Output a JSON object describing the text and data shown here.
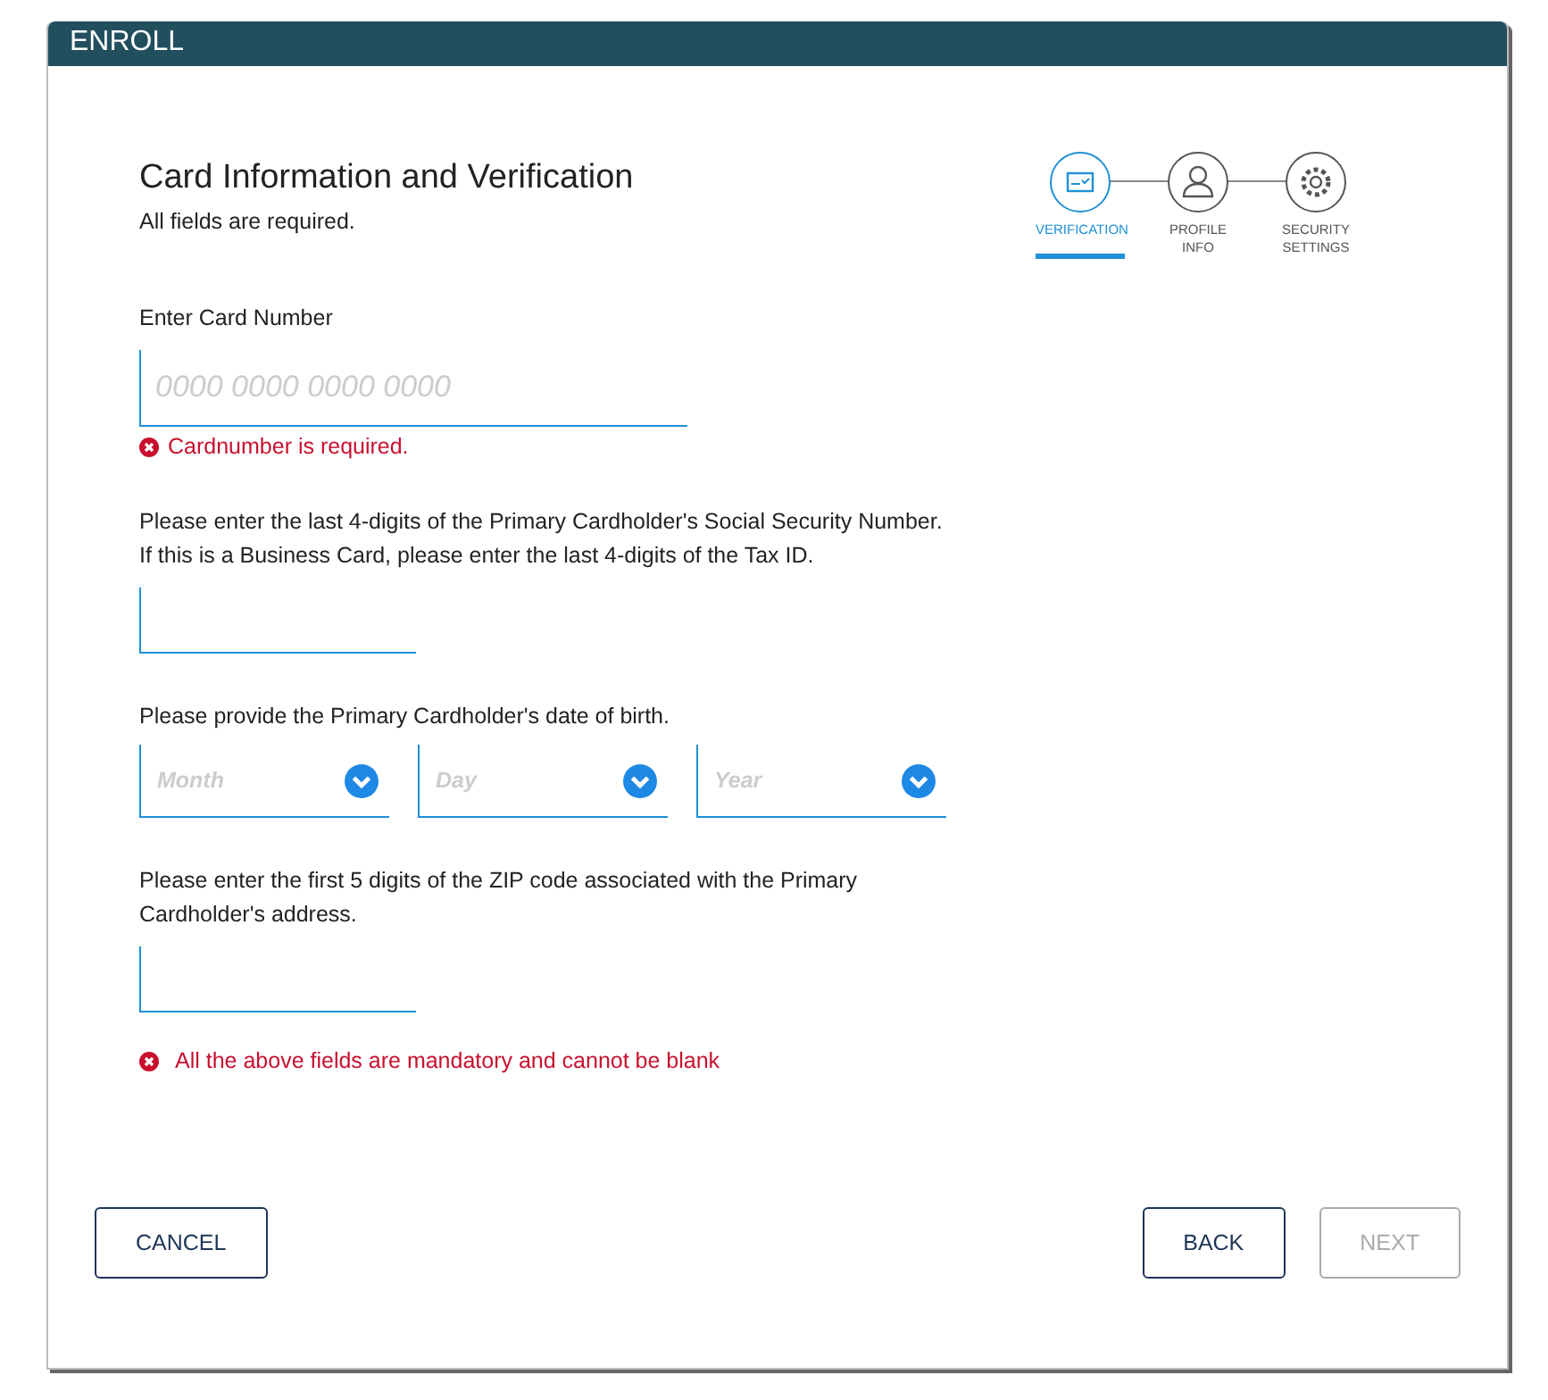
{
  "window": {
    "title": "ENROLL"
  },
  "heading": "Card Information and Verification",
  "subheading": "All fields are required.",
  "steps": [
    {
      "label": "VERIFICATION",
      "selected": true,
      "kind": "card"
    },
    {
      "label": "PROFILE INFO",
      "selected": false,
      "kind": "person"
    },
    {
      "label": "SECURITY SETTINGS",
      "selected": false,
      "kind": "gear"
    }
  ],
  "card_number": {
    "label": "Enter Card Number",
    "placeholder": "0000 0000 0000 0000",
    "error": "Cardnumber is required."
  },
  "ssn": {
    "label": "Please enter the last 4-digits of the Primary Cardholder's Social Security Number. If this is a Business Card, please enter the last 4-digits of the Tax ID."
  },
  "dob": {
    "label": "Please provide the Primary Cardholder's date of birth.",
    "selects": [
      {
        "placeholder": "Month"
      },
      {
        "placeholder": "Day"
      },
      {
        "placeholder": "Year"
      }
    ]
  },
  "zip": {
    "label": "Please enter the first 5 digits of the ZIP code associated with the Primary Cardholder's address."
  },
  "form_error": "All the above fields are mandatory and cannot be blank",
  "buttons": [
    {
      "label": "CANCEL",
      "disabled": false,
      "kind": "left"
    },
    {
      "label": "BACK",
      "disabled": false,
      "kind": "right"
    },
    {
      "label": "NEXT",
      "disabled": true,
      "kind": "right"
    }
  ]
}
